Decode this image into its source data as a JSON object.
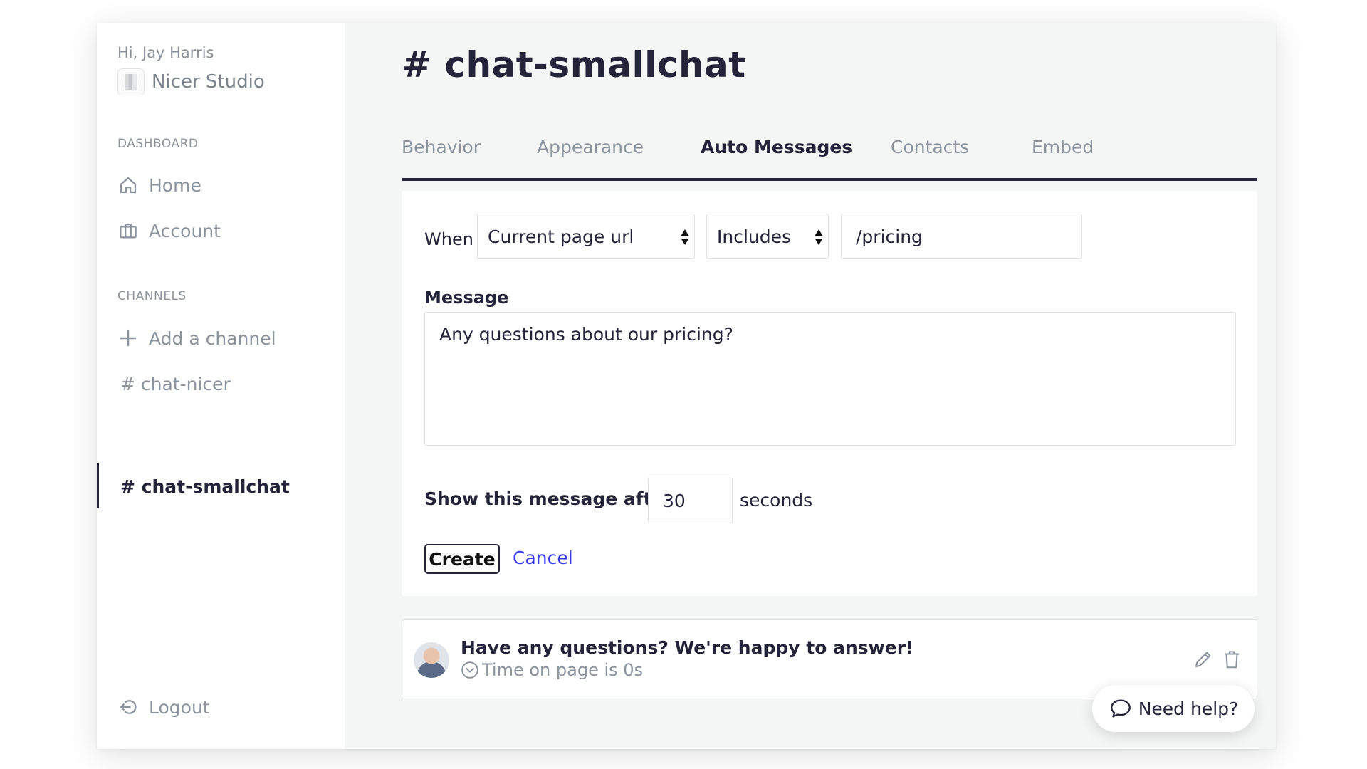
{
  "sidebar": {
    "greeting": "Hi, Jay Harris",
    "org_name": "Nicer Studio",
    "dashboard_label": "DASHBOARD",
    "home_label": "Home",
    "account_label": "Account",
    "channels_label": "CHANNELS",
    "add_channel_label": "Add a channel",
    "channels": [
      "# chat-nicer",
      "# chat-smallchat"
    ],
    "logout_label": "Logout"
  },
  "page": {
    "title": "# chat-smallchat"
  },
  "tabs": [
    "Behavior",
    "Appearance",
    "Auto Messages",
    "Contacts",
    "Embed"
  ],
  "active_tab": "Auto Messages",
  "form": {
    "when_label": "When",
    "condition_field": "Current page url",
    "operator": "Includes",
    "value": "/pricing",
    "message_label": "Message",
    "message": "Any questions about our pricing?",
    "delay_label": "Show this message after",
    "delay_value": "30",
    "delay_unit": "seconds",
    "create_label": "Create",
    "cancel_label": "Cancel"
  },
  "auto_messages": [
    {
      "text": "Have any questions? We're happy to answer!",
      "trigger": "Time on page is 0s"
    }
  ],
  "help_widget": {
    "label": "Need help?"
  },
  "colors": {
    "text_dark": "#232339",
    "text_muted": "#8b949c",
    "link": "#3a3af0",
    "background": "#f4f5f5"
  },
  "icons": [
    "home-icon",
    "briefcase-icon",
    "plus-icon",
    "logout-icon",
    "clock-icon",
    "pencil-icon",
    "trash-icon",
    "chat-bubble-icon"
  ]
}
